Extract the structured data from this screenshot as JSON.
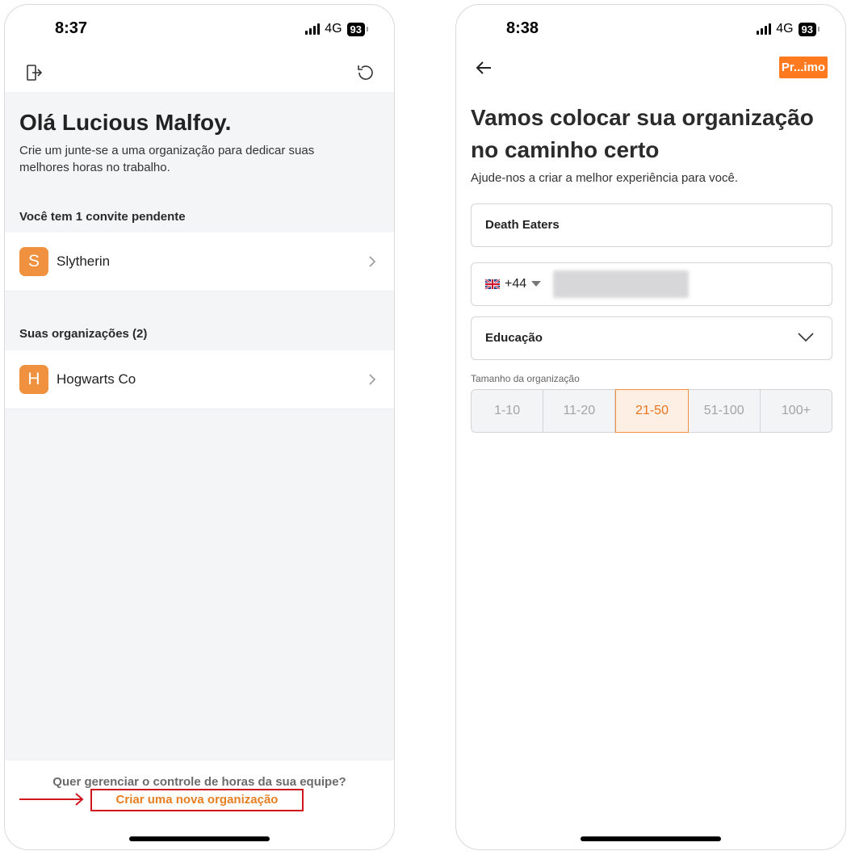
{
  "left": {
    "status": {
      "time": "8:37",
      "network": "4G",
      "battery": "93"
    },
    "greeting": "Olá Lucious Malfoy.",
    "subtitle": "Crie um junte-se a uma organização para dedicar suas melhores horas no trabalho.",
    "invites_label": "Você tem 1 convite pendente",
    "invites": [
      {
        "initial": "S",
        "name": "Slytherin"
      }
    ],
    "orgs_label": "Suas organizações (2)",
    "orgs": [
      {
        "initial": "H",
        "name": "Hogwarts Co"
      }
    ],
    "footer_question": "Quer gerenciar o controle de horas da sua equipe?",
    "create_link": "Criar uma nova organização",
    "accent_color": "#e67e22",
    "highlight_color": "#d0161c"
  },
  "right": {
    "status": {
      "time": "8:38",
      "network": "4G",
      "battery": "93"
    },
    "next_button": "Pr...imo",
    "title": "Vamos colocar sua organização no caminho certo",
    "subtitle": "Ajude-nos a criar a melhor experiência para você.",
    "org_name_value": "Death Eaters",
    "phone_code": "+44",
    "industry_value": "Educação",
    "size_label": "Tamanho da organização",
    "size_options": [
      "1-10",
      "11-20",
      "21-50",
      "51-100",
      "100+"
    ],
    "size_selected": "21-50",
    "accent_color": "#ff7a1e"
  }
}
